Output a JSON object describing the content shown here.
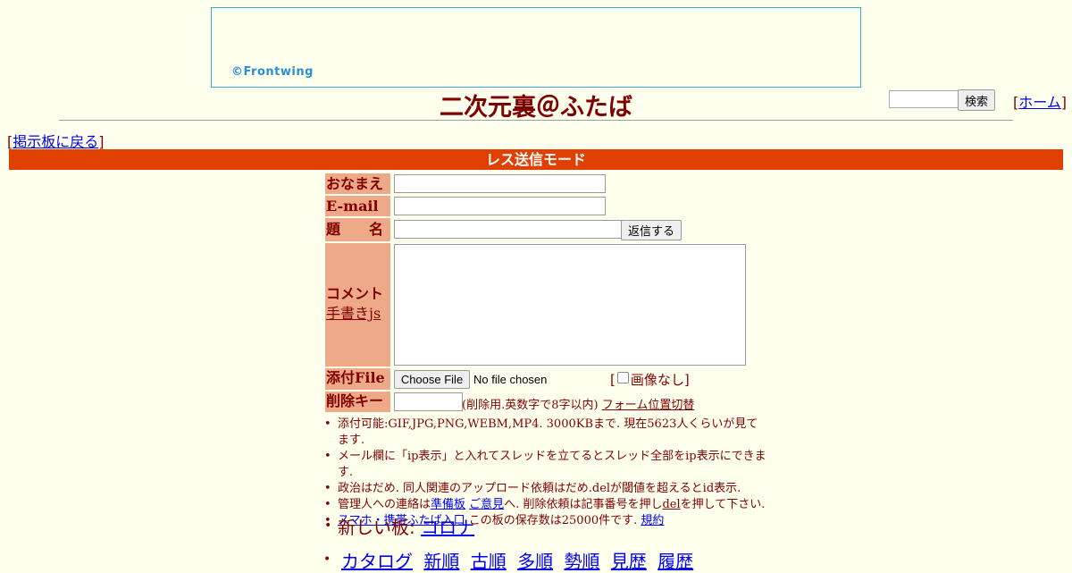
{
  "banner": {
    "logo_text": "©Frontwing"
  },
  "header": {
    "title": "二次元裏＠ふたば",
    "search_value": "",
    "search_button": "検索",
    "home_open": "[",
    "home_link": "ホーム",
    "home_close": "]"
  },
  "nav": {
    "back_open": "[",
    "back_link": "掲示板に戻る",
    "back_close": "]"
  },
  "mode_bar": "レス送信モード",
  "form": {
    "name_label": "おなまえ",
    "email_label": "E-mail",
    "subject_label": "題　　名",
    "submit_button": "返信する",
    "comment_label": "コメント",
    "oekaki_link": "手書きjs",
    "file_label": "添付File",
    "choose_file_button": "Choose File",
    "no_file_text": "No file chosen",
    "no_image_open": "[",
    "no_image_label": "画像なし",
    "no_image_close": "]",
    "delete_key_label": "削除キー",
    "delete_key_note": "(削除用.英数字で8字以内)",
    "form_position_link": "フォーム位置切替"
  },
  "notes": {
    "line1": "添付可能:GIF,JPG,PNG,WEBM,MP4. 3000KBまで. 現在5623人くらいが見てます.",
    "line2": "メール欄に「ip表示」と入れてスレッドを立てるとスレッド全部をip表示にできます.",
    "line3": "政治はだめ. 同人関連のアップロード依頼はだめ.delが閾値を超えるとid表示.",
    "line4_prefix": "管理人への連絡は",
    "line4_link1": "準備板",
    "line4_link2": "ご意見",
    "line4_mid": "へ. 削除依頼は記事番号を押し",
    "line4_link3": "del",
    "line4_suffix": "を押して下さい.",
    "line5_link": "スマホ・携帯ふたば入口",
    "line5_text": " この板の保存数は25000件です.",
    "line5_link2": "規約"
  },
  "new_board": {
    "label": "新しい板: ",
    "link": "コロナ"
  },
  "catalog_nav": [
    "カタログ",
    "新順",
    "古順",
    "多順",
    "勢順",
    "見歴",
    "履歴"
  ],
  "colors": {
    "background": "#ffffee",
    "text": "#800000",
    "label_bg": "#eeaa88",
    "mode_bar": "#e04000"
  }
}
